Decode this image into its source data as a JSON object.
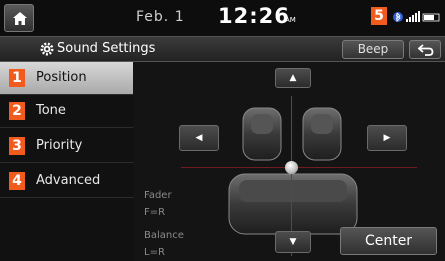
{
  "status": {
    "date": "Feb.  1",
    "time": "12:26",
    "ampm": "AM"
  },
  "title_bar": {
    "title": "Sound Settings",
    "beep_label": "Beep"
  },
  "menu": [
    {
      "num": "1",
      "label": "Position",
      "active": true
    },
    {
      "num": "2",
      "label": "Tone",
      "active": false
    },
    {
      "num": "3",
      "label": "Priority",
      "active": false
    },
    {
      "num": "4",
      "label": "Advanced",
      "active": false
    }
  ],
  "callout_status": "5",
  "controls": {
    "center_label": "Center",
    "up": "▲",
    "down": "▼",
    "left": "◀",
    "right": "▶"
  },
  "readouts": {
    "fader_label": "Fader",
    "fader_value": "F=R",
    "balance_label": "Balance",
    "balance_value": "L=R"
  },
  "colors": {
    "badge": "#f25b1e",
    "crosshair": "#b3202b"
  }
}
